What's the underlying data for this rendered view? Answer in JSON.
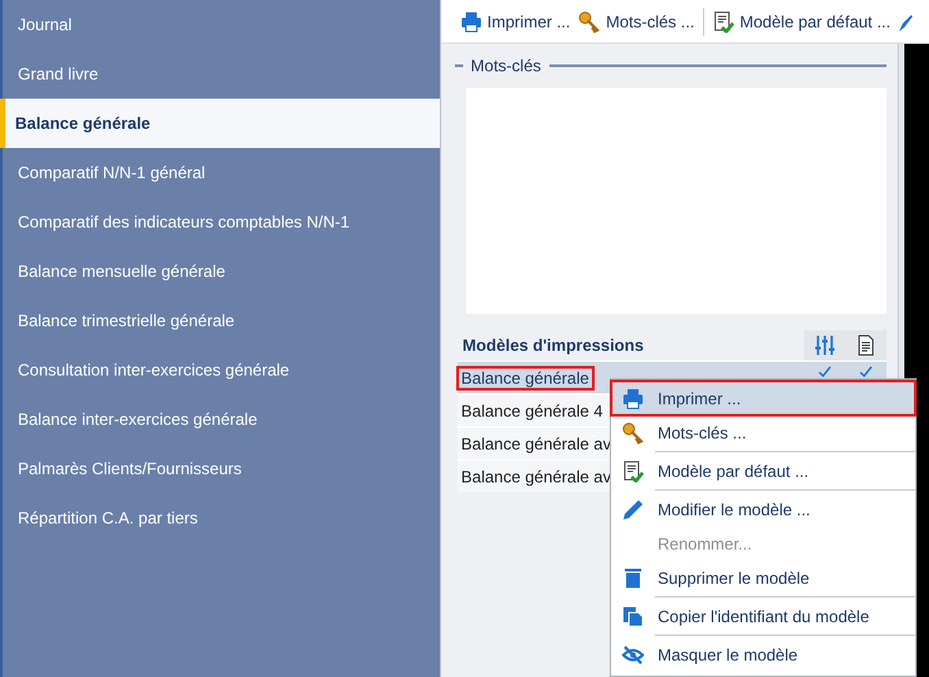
{
  "sidebar": {
    "items": [
      {
        "label": "Journal",
        "selected": false
      },
      {
        "label": "Grand livre",
        "selected": false
      },
      {
        "label": "Balance générale",
        "selected": true
      },
      {
        "label": "Comparatif N/N-1 général",
        "selected": false
      },
      {
        "label": "Comparatif des indicateurs comptables N/N-1",
        "selected": false
      },
      {
        "label": "Balance mensuelle générale",
        "selected": false
      },
      {
        "label": "Balance trimestrielle générale",
        "selected": false
      },
      {
        "label": "Consultation inter-exercices générale",
        "selected": false
      },
      {
        "label": "Balance inter-exercices générale",
        "selected": false
      },
      {
        "label": "Palmarès Clients/Fournisseurs",
        "selected": false
      },
      {
        "label": "Répartition C.A. par tiers",
        "selected": false
      }
    ]
  },
  "toolbar": [
    {
      "kind": "print",
      "label": "Imprimer ..."
    },
    {
      "kind": "key",
      "label": "Mots-clés ..."
    },
    {
      "kind": "separator"
    },
    {
      "kind": "default",
      "label": "Modèle par défaut ..."
    }
  ],
  "keywords": {
    "title": "Mots-clés"
  },
  "models": {
    "title": "Modèles d'impressions",
    "rows": [
      {
        "label": "Balance générale",
        "selected": true,
        "outlined": true,
        "print": true,
        "default": true
      },
      {
        "label": "Balance générale 4",
        "selected": false,
        "outlined": false
      },
      {
        "label": "Balance générale av",
        "selected": false,
        "outlined": false
      },
      {
        "label": "Balance générale av",
        "selected": false,
        "outlined": false
      }
    ]
  },
  "context_menu": [
    {
      "kind": "print",
      "label": "Imprimer ...",
      "selected": true,
      "outlined": true,
      "disabled": false
    },
    {
      "kind": "key",
      "label": "Mots-clés ...",
      "selected": false,
      "outlined": false,
      "disabled": false
    },
    {
      "kind": "separator"
    },
    {
      "kind": "default",
      "label": "Modèle par défaut ...",
      "selected": false,
      "outlined": false,
      "disabled": false
    },
    {
      "kind": "separator"
    },
    {
      "kind": "edit",
      "label": "Modifier le modèle ...",
      "selected": false,
      "outlined": false,
      "disabled": false
    },
    {
      "kind": "none",
      "label": "Renommer...",
      "selected": false,
      "outlined": false,
      "disabled": true
    },
    {
      "kind": "delete",
      "label": "Supprimer le modèle",
      "selected": false,
      "outlined": false,
      "disabled": false
    },
    {
      "kind": "separator"
    },
    {
      "kind": "copy",
      "label": "Copier l'identifiant du modèle",
      "selected": false,
      "outlined": false,
      "disabled": false
    },
    {
      "kind": "separator"
    },
    {
      "kind": "hide",
      "label": "Masquer le modèle",
      "selected": false,
      "outlined": false,
      "disabled": false
    }
  ]
}
